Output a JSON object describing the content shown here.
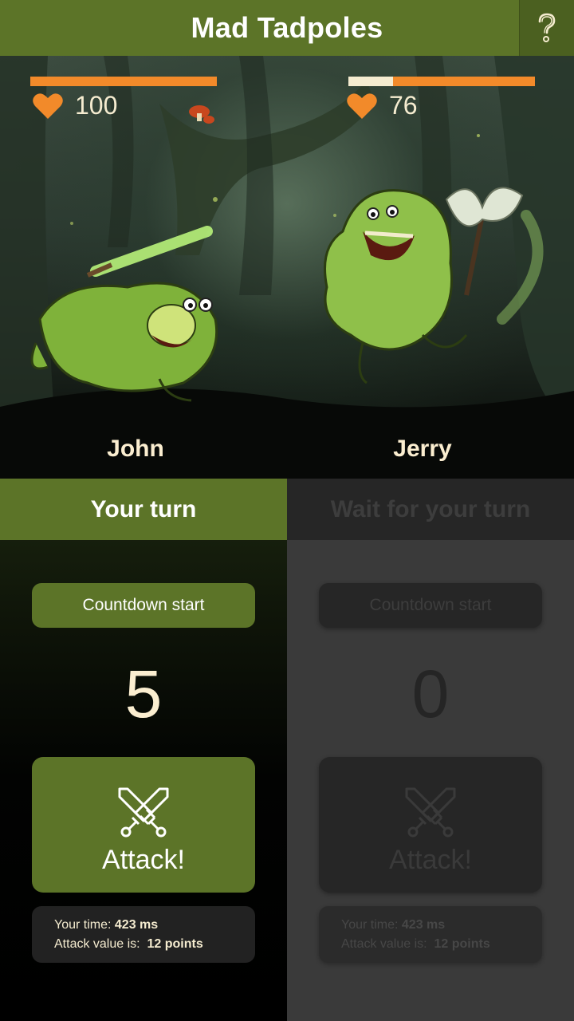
{
  "app": {
    "title": "Mad Tadpoles"
  },
  "header": {
    "help_icon": "question-mark-icon"
  },
  "players": {
    "left": {
      "name": "John",
      "hp": 100,
      "hp_fraction": 1.0
    },
    "right": {
      "name": "Jerry",
      "hp": 76,
      "hp_fraction": 0.76
    }
  },
  "panels": {
    "left": {
      "turn_label": "Your turn",
      "countdown_label": "Countdown start",
      "counter": "5",
      "attack_label": "Attack!",
      "time_label": "Your time:",
      "time_value": "423 ms",
      "attack_value_label": "Attack value is:",
      "attack_value": "12 points"
    },
    "right": {
      "turn_label": "Wait for your turn",
      "countdown_label": "Countdown start",
      "counter": "0",
      "attack_label": "Attack!",
      "time_label": "Your time:",
      "time_value": "423 ms",
      "attack_value_label": "Attack value is:",
      "attack_value": "12 points"
    }
  },
  "colors": {
    "brand_green": "#5c7428",
    "hp_orange": "#f28a2a",
    "cream": "#fbeed0",
    "disabled_dark": "#262626"
  }
}
